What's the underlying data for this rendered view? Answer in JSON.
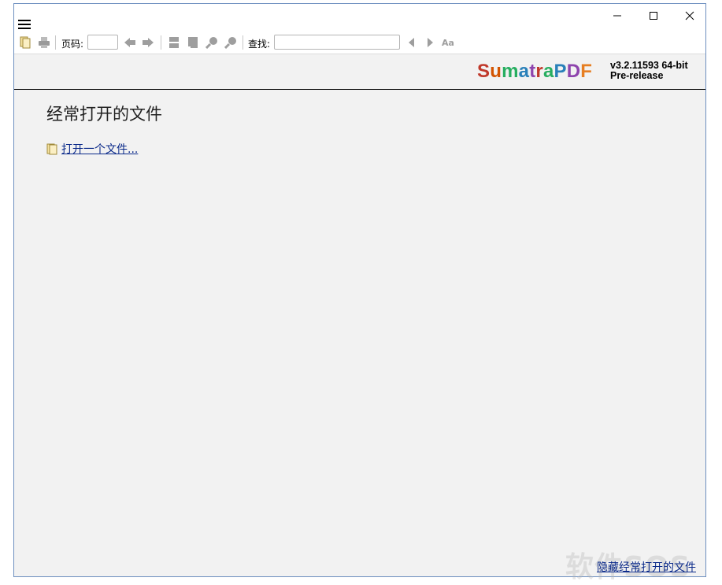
{
  "window": {
    "controls": {
      "minimize_icon": "minimize-icon",
      "maximize_icon": "maximize-icon",
      "close_icon": "close-icon"
    }
  },
  "toolbar": {
    "page_label": "页码:",
    "page_value": "",
    "find_label": "查找:",
    "find_value": ""
  },
  "branding": {
    "logo_letters": [
      "S",
      "u",
      "m",
      "a",
      "t",
      "r",
      "a",
      "P",
      "D",
      "F"
    ],
    "logo_colors": [
      "#c0392b",
      "#d35400",
      "#27ae60",
      "#2980b9",
      "#8e44ad",
      "#c0392b",
      "#27ae60",
      "#2980b9",
      "#8e44ad",
      "#e67e22"
    ],
    "version_line1": "v3.2.11593 64-bit",
    "version_line2": "Pre-release"
  },
  "main": {
    "heading": "经常打开的文件",
    "open_file_label": "打开一个文件...",
    "hide_frequent_label": "隐藏经常打开的文件"
  },
  "watermark": "软件SOS"
}
